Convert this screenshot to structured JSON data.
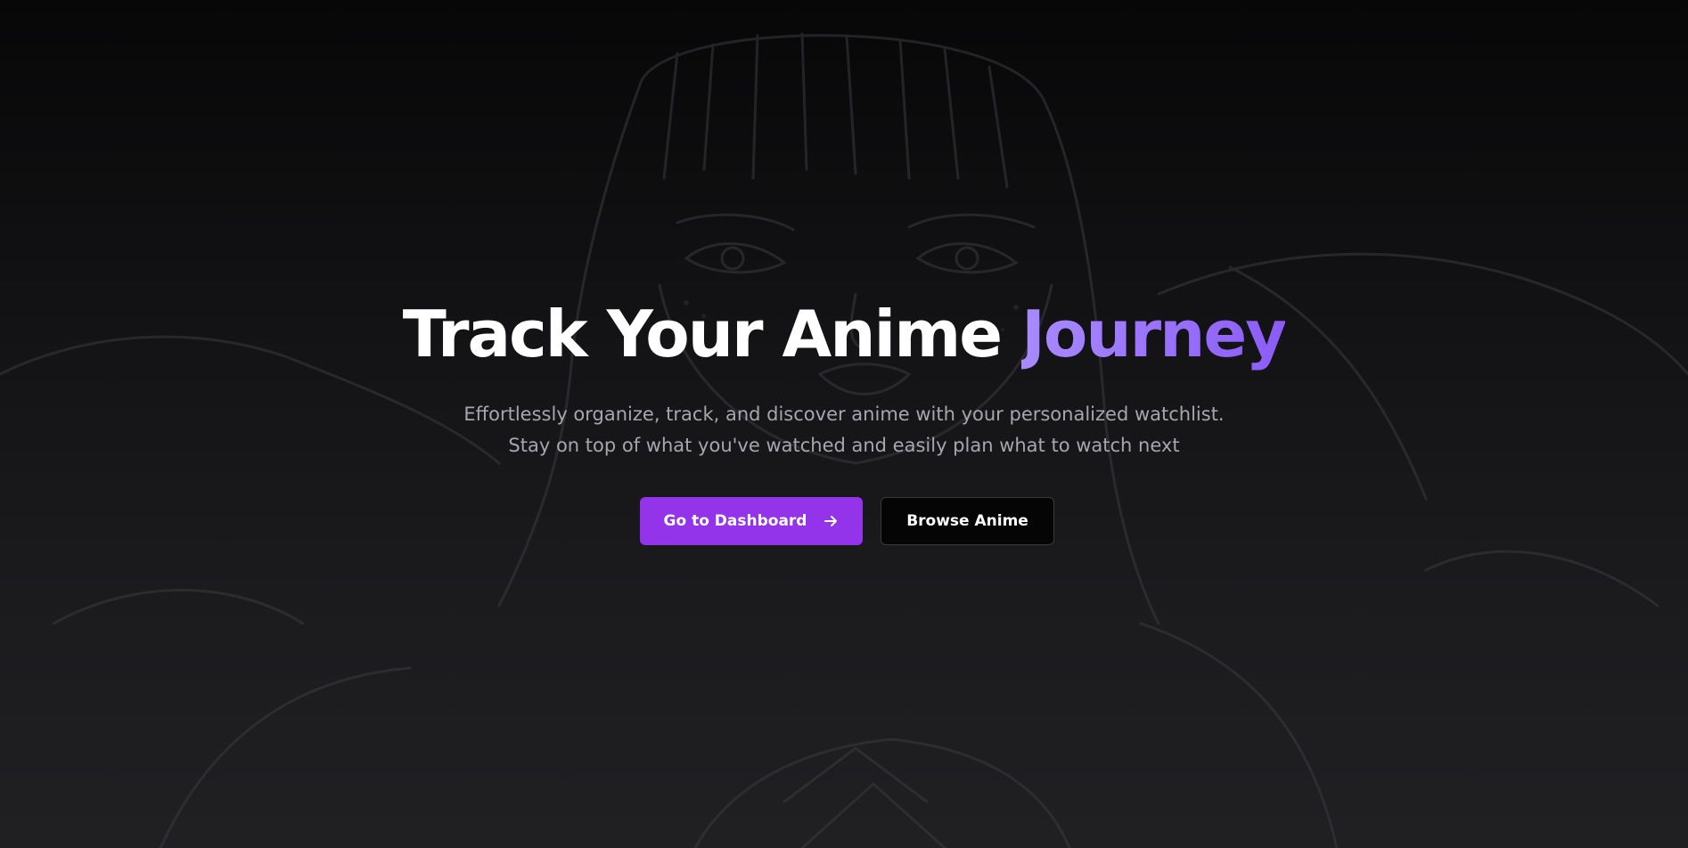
{
  "hero": {
    "title_main": "Track Your Anime ",
    "title_accent": "Journey",
    "subtitle": "Effortlessly organize, track, and discover anime with your personalized watchlist. Stay on top of what you've watched and easily plan what to watch next"
  },
  "actions": {
    "primary_label": "Go to Dashboard",
    "primary_icon": "arrow-right-icon",
    "secondary_label": "Browse Anime"
  },
  "colors": {
    "accent": "#9333ea",
    "accent_text": "#9b73fb",
    "background": "#0a0a0b"
  }
}
